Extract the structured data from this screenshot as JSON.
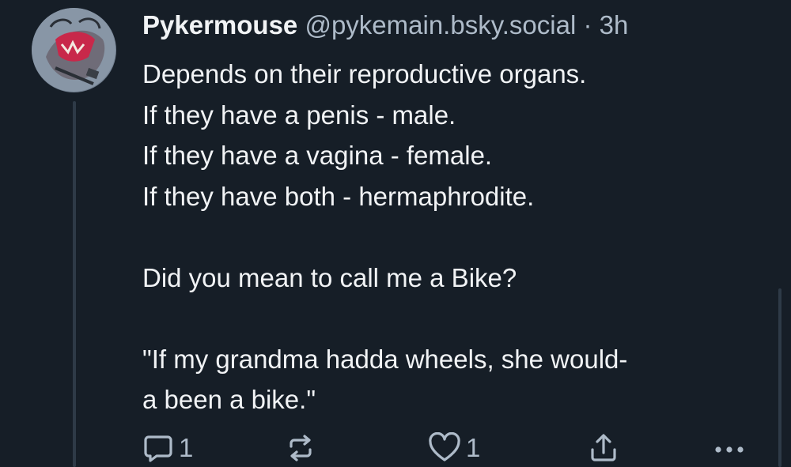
{
  "post": {
    "author": {
      "display_name": "Pykermouse",
      "handle": "@pykemain.bsky.social",
      "separator": "·",
      "time": "3h"
    },
    "text": "Depends on their reproductive organs.\nIf they have a penis - male.\nIf they have a vagina - female.\nIf they have both - hermaphrodite.\n\nDid you mean to call me a Bike?\n\n\"If my grandma hadda wheels, she would-\na been a bike.\""
  },
  "actions": {
    "reply_count": "1",
    "like_count": "1",
    "icons": {
      "reply": "reply-bubble-icon",
      "repost": "repost-icon",
      "like": "heart-icon",
      "share": "share-icon",
      "more": "more-dots-icon"
    }
  },
  "colors": {
    "background": "#161e27",
    "text": "#f1f3f5",
    "muted": "#aebbc9",
    "thread_line": "#2e3a47"
  }
}
